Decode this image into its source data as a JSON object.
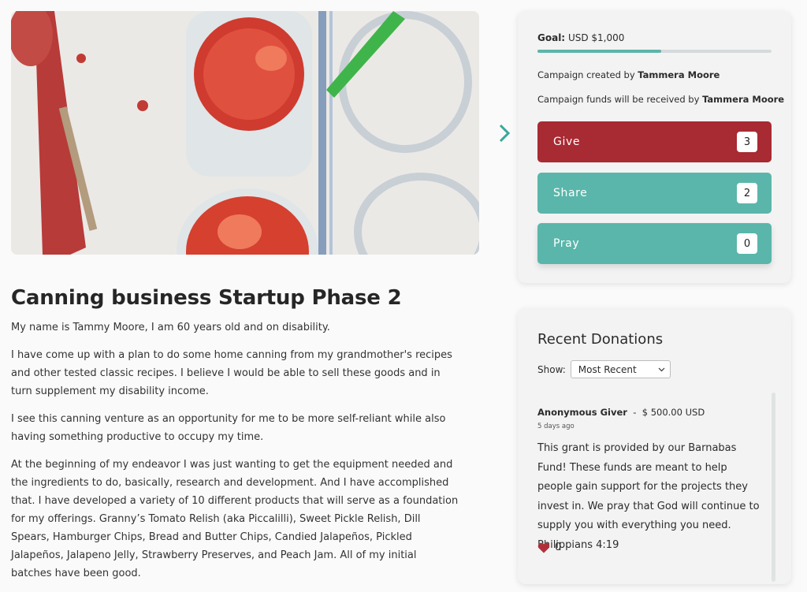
{
  "campaign": {
    "title": "Canning business Startup Phase 2",
    "story": [
      "My name is Tammy Moore, I am 60 years old and on disability.",
      "I have come up with a plan to do some home canning from my grandmother's recipes and other tested classic recipes. I believe I would be able to sell these goods and in turn supplement my disability income.",
      "I see this canning venture as an opportunity for me to be more self-reliant while also having something productive to occupy my time.",
      "At the beginning of my endeavor I was just wanting to get the equipment needed and the ingredients to do, basically, research and development. And I have accomplished that. I have developed a variety of 10 different products that will serve as a foundation for my offerings. Granny’s Tomato Relish (aka Piccalilli), Sweet Pickle Relish, Dill Spears, Hamburger Chips, Bread and Butter Chips, Candied Jalapeños, Pickled Jalapeños, Jalapeno Jelly, Strawberry Preserves, and Peach Jam. All of my initial batches have been good."
    ]
  },
  "goal": {
    "label": "Goal:",
    "amount": "USD $1,000",
    "progress_fraction": 0.53,
    "created_prefix": "Campaign created by",
    "creator": "Tammera Moore",
    "funds_prefix": "Campaign funds will be received by",
    "recipient": "Tammera Moore"
  },
  "actions": [
    {
      "label": "Give",
      "count": "3"
    },
    {
      "label": "Share",
      "count": "2"
    },
    {
      "label": "Pray",
      "count": "0"
    }
  ],
  "donations": {
    "title": "Recent Donations",
    "show_label": "Show:",
    "filter_selected": "Most Recent",
    "items": [
      {
        "donor": "Anonymous Giver",
        "separator": "-",
        "amount": "$ 500.00 USD",
        "time": "5 days ago",
        "message": "This grant is provided by our Barnabas Fund! These funds are meant to help people gain support for the projects they invest in. We pray that God will continue to supply you with everything you need. Philippians 4:19",
        "likes": "0"
      }
    ]
  },
  "colors": {
    "give": "#a82a33",
    "accent": "#5ab6aa",
    "heart": "#b0303a"
  },
  "icons": {
    "next": "chevron-right-icon",
    "like": "heart-icon",
    "select": "chevron-down-icon"
  }
}
